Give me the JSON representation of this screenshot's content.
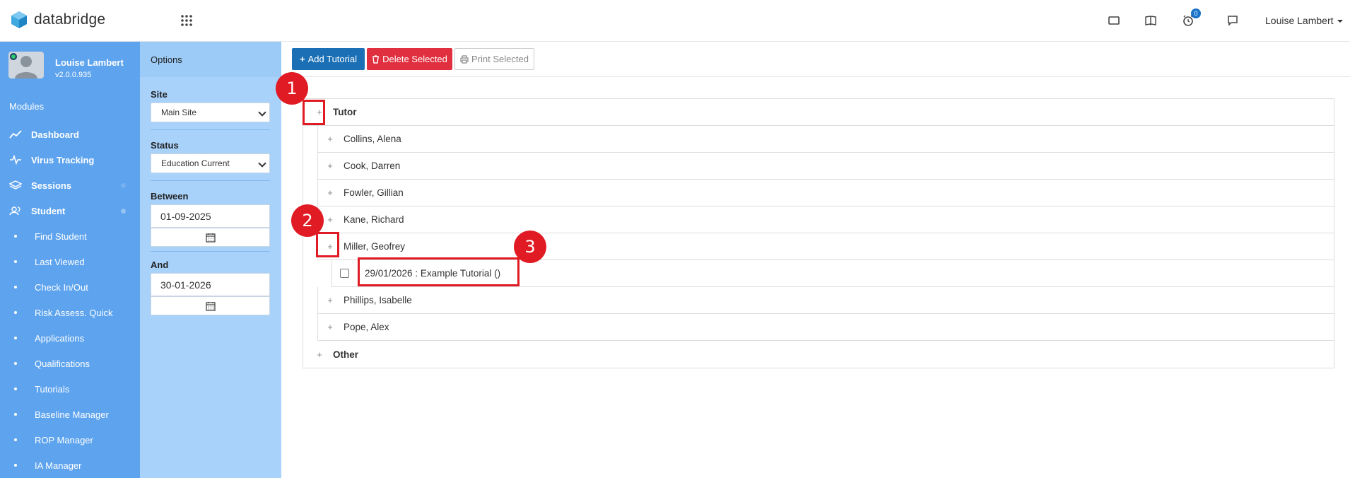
{
  "header": {
    "brand": "databridge",
    "notification_count": "0",
    "user_name": "Louise Lambert",
    "icons": [
      "grid-icon",
      "monitor-icon",
      "book-icon",
      "alarm-icon",
      "chat-icon"
    ]
  },
  "sidebar": {
    "user_name": "Louise Lambert",
    "version": "v2.0.0.935",
    "modules_label": "Modules",
    "items": [
      {
        "label": "Dashboard",
        "icon": "chart-line-icon"
      },
      {
        "label": "Virus Tracking",
        "icon": "pulse-icon"
      },
      {
        "label": "Sessions",
        "icon": "layers-icon"
      },
      {
        "label": "Student",
        "icon": "users-icon"
      },
      {
        "label": "Find Student"
      },
      {
        "label": "Last Viewed"
      },
      {
        "label": "Check In/Out"
      },
      {
        "label": "Risk Assess. Quick"
      },
      {
        "label": "Applications"
      },
      {
        "label": "Qualifications"
      },
      {
        "label": "Tutorials"
      },
      {
        "label": "Baseline Manager"
      },
      {
        "label": "ROP Manager"
      },
      {
        "label": "IA Manager"
      }
    ]
  },
  "options": {
    "title": "Options",
    "site_label": "Site",
    "site_value": "Main Site",
    "status_label": "Status",
    "status_value": "Education Current",
    "between_label": "Between",
    "between_value": "01-09-2025",
    "and_label": "And",
    "and_value": "30-01-2026"
  },
  "toolbar": {
    "add_label": "Add Tutorial",
    "delete_label": "Delete Selected",
    "print_label": "Print Selected"
  },
  "tree": {
    "tutor_label": "Tutor",
    "tutors": [
      "Collins, Alena",
      "Cook, Darren",
      "Fowler, Gillian",
      "Kane, Richard",
      "Miller, Geofrey",
      "Phillips, Isabelle",
      "Pope, Alex"
    ],
    "tutorial_entry": "29/01/2026 : Example Tutorial ()",
    "other_label": "Other"
  },
  "annotations": [
    "1",
    "2",
    "3"
  ],
  "colors": {
    "sidebar": "#5da3ee",
    "options_panel": "#a9d2fb",
    "add_button": "#1a6fb5",
    "delete_button": "#e02f3f",
    "annotation": "#e01b24"
  }
}
